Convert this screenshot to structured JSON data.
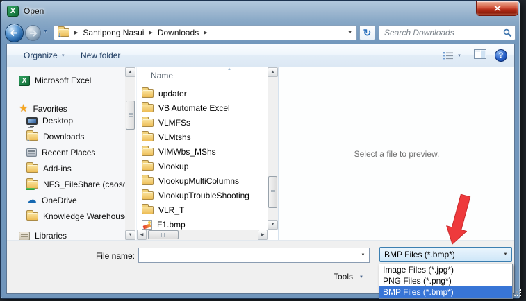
{
  "window": {
    "title": "Open"
  },
  "address": {
    "crumbs": [
      "Santipong Nasui",
      "Downloads"
    ],
    "search_placeholder": "Search Downloads"
  },
  "toolbar": {
    "organize_label": "Organize",
    "new_folder_label": "New folder"
  },
  "sidebar": {
    "excel_label": "Microsoft Excel",
    "favorites_label": "Favorites",
    "items": [
      "Desktop",
      "Downloads",
      "Recent Places",
      "Add-ins",
      "NFS_FileShare (caosdfs",
      "OneDrive",
      "Knowledge Warehouse"
    ],
    "libraries_label": "Libraries"
  },
  "file_list": {
    "column_header": "Name",
    "items": [
      {
        "name": "updater",
        "type": "folder"
      },
      {
        "name": "VB Automate Excel",
        "type": "folder"
      },
      {
        "name": "VLMFSs",
        "type": "folder"
      },
      {
        "name": "VLMtshs",
        "type": "folder"
      },
      {
        "name": "VIMWbs_MShs",
        "type": "folder"
      },
      {
        "name": "Vlookup",
        "type": "folder"
      },
      {
        "name": "VlookupMultiColumns",
        "type": "folder"
      },
      {
        "name": "VlookupTroubleShooting",
        "type": "folder"
      },
      {
        "name": "VLR_T",
        "type": "folder"
      },
      {
        "name": "F1.bmp",
        "type": "bmp-image"
      }
    ]
  },
  "preview": {
    "message": "Select a file to preview."
  },
  "footer": {
    "file_name_label": "File name:",
    "file_name_value": "",
    "tools_label": "Tools"
  },
  "file_type": {
    "selected": "BMP Files (*.bmp*)",
    "options": [
      "Image Files (*.jpg*)",
      "PNG Files (*.png*)",
      "BMP Files (*.bmp*)"
    ],
    "selected_index": 2,
    "highlight_color": "#3875d6"
  },
  "annotation": {
    "arrow_color": "#ee3a3c"
  }
}
